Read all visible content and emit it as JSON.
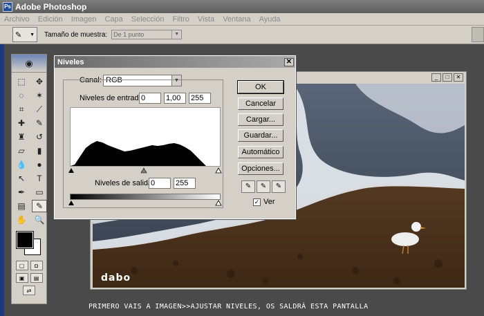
{
  "app": {
    "title": "Adobe Photoshop",
    "icon": "ps-icon"
  },
  "menu": [
    "Archivo",
    "Edición",
    "Imagen",
    "Capa",
    "Selección",
    "Filtro",
    "Vista",
    "Ventana",
    "Ayuda"
  ],
  "options": {
    "sample_label": "Tamaño de muestra:",
    "sample_value": "De 1 punto"
  },
  "photo": {
    "watermark": "dabo"
  },
  "levels": {
    "title": "Niveles",
    "channel_label": "Canal:",
    "channel_value": "RGB",
    "input_label": "Niveles de entrada:",
    "input_black": "0",
    "input_gamma": "1,00",
    "input_white": "255",
    "output_label": "Niveles de salida:",
    "output_black": "0",
    "output_white": "255",
    "buttons": {
      "ok": "OK",
      "cancel": "Cancelar",
      "load": "Cargar...",
      "save": "Guardar...",
      "auto": "Automático",
      "options": "Opciones..."
    },
    "preview_label": "Ver",
    "preview_checked": true
  },
  "caption": "PRIMERO VAIS A IMAGEN>>AJUSTAR NIVELES, OS SALDRÁ ESTA PANTALLA"
}
